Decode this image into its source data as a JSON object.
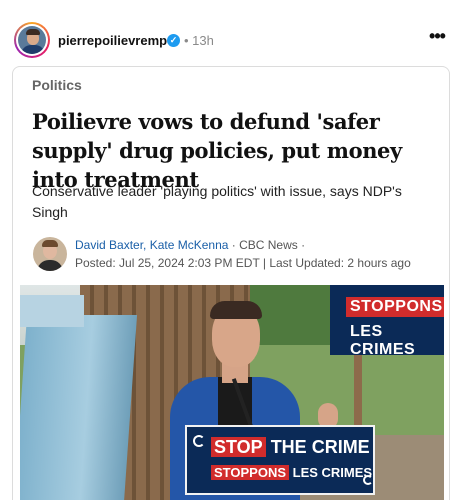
{
  "post": {
    "username": "pierrepoilievremp",
    "verified_mark": "✓",
    "timestamp": "• 13h",
    "more_icon": "•••"
  },
  "article": {
    "category": "Politics",
    "headline": "Poilievre vows to defund 'safer supply' drug policies, put money into treatment",
    "subhead": "Conservative leader 'playing politics' with issue, says NDP's Singh",
    "authors": "David Baxter, Kate McKenna",
    "source": " · CBC News ·",
    "posted": "Posted: Jul 25, 2024 2:03 PM EDT | Last Updated: 2 hours ago"
  },
  "photo": {
    "top_sign_line1": "STOPPONS",
    "top_sign_line2": "LES CRIMES",
    "podium_stop": "STOP",
    "podium_the_crime": " THE CRIME",
    "podium_stoppons": "STOPPONS",
    "podium_les_crimes": " LES CRIMES"
  },
  "colors": {
    "verified": "#1d9bf0",
    "author_link": "#1a5fa8",
    "sign_blue": "#0b2a57",
    "sign_red": "#d12c2c"
  }
}
